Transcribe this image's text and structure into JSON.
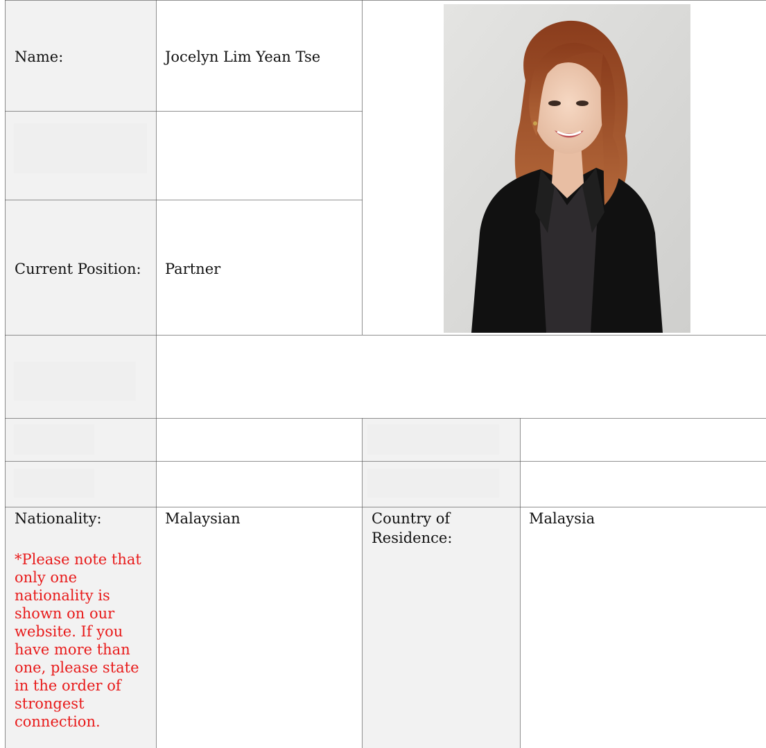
{
  "profile": {
    "name_label": "Name:",
    "name_value": "Jocelyn Lim Yean Tse",
    "position_label": "Current Position:",
    "position_value": "Partner",
    "nationality_label": "Nationality:",
    "nationality_value": "Malaysian",
    "nationality_note": "*Please note that only one nationality is shown on our website. If you have more than one, please state in the order of strongest connection.",
    "residence_label": "Country of Residence:",
    "residence_value": "Malaysia"
  },
  "colors": {
    "label_background": "#f2f2f2",
    "note_text": "#e81a1a",
    "grid_lines": "#555555"
  },
  "photo": {
    "subject": "portrait of woman in black blazer"
  }
}
